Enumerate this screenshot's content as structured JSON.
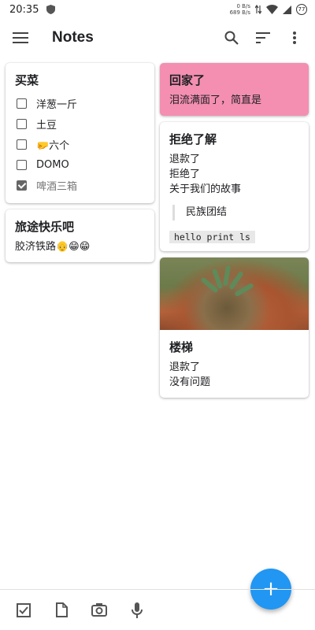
{
  "status_bar": {
    "time": "20:35",
    "net_up": "0 B/s",
    "net_down": "689 B/s",
    "battery": "77"
  },
  "app_bar": {
    "title": "Notes"
  },
  "notes": {
    "shopping": {
      "title": "买菜",
      "items": [
        {
          "label": "洋葱一斤",
          "checked": false
        },
        {
          "label": "土豆",
          "checked": false
        },
        {
          "label": "🤛六个",
          "checked": false
        },
        {
          "label": "DOMO",
          "checked": false
        },
        {
          "label": "啤酒三箱",
          "checked": true
        }
      ]
    },
    "travel": {
      "title": "旅途快乐吧",
      "text": "胶济铁路👴😁😁"
    },
    "home": {
      "title": "回家了",
      "text": "泪流满面了，简直是",
      "color": "#f48fb1"
    },
    "refuse": {
      "title": "拒绝了解",
      "lines": [
        "退款了",
        "拒绝了",
        "关于我们的故事"
      ],
      "quote": "民族团结",
      "code": "hello print ls"
    },
    "stairs": {
      "title": "楼梯",
      "lines": [
        "退款了",
        "没有问题"
      ]
    }
  },
  "fab": {
    "label": "+"
  },
  "accent_color": "#2196f3"
}
